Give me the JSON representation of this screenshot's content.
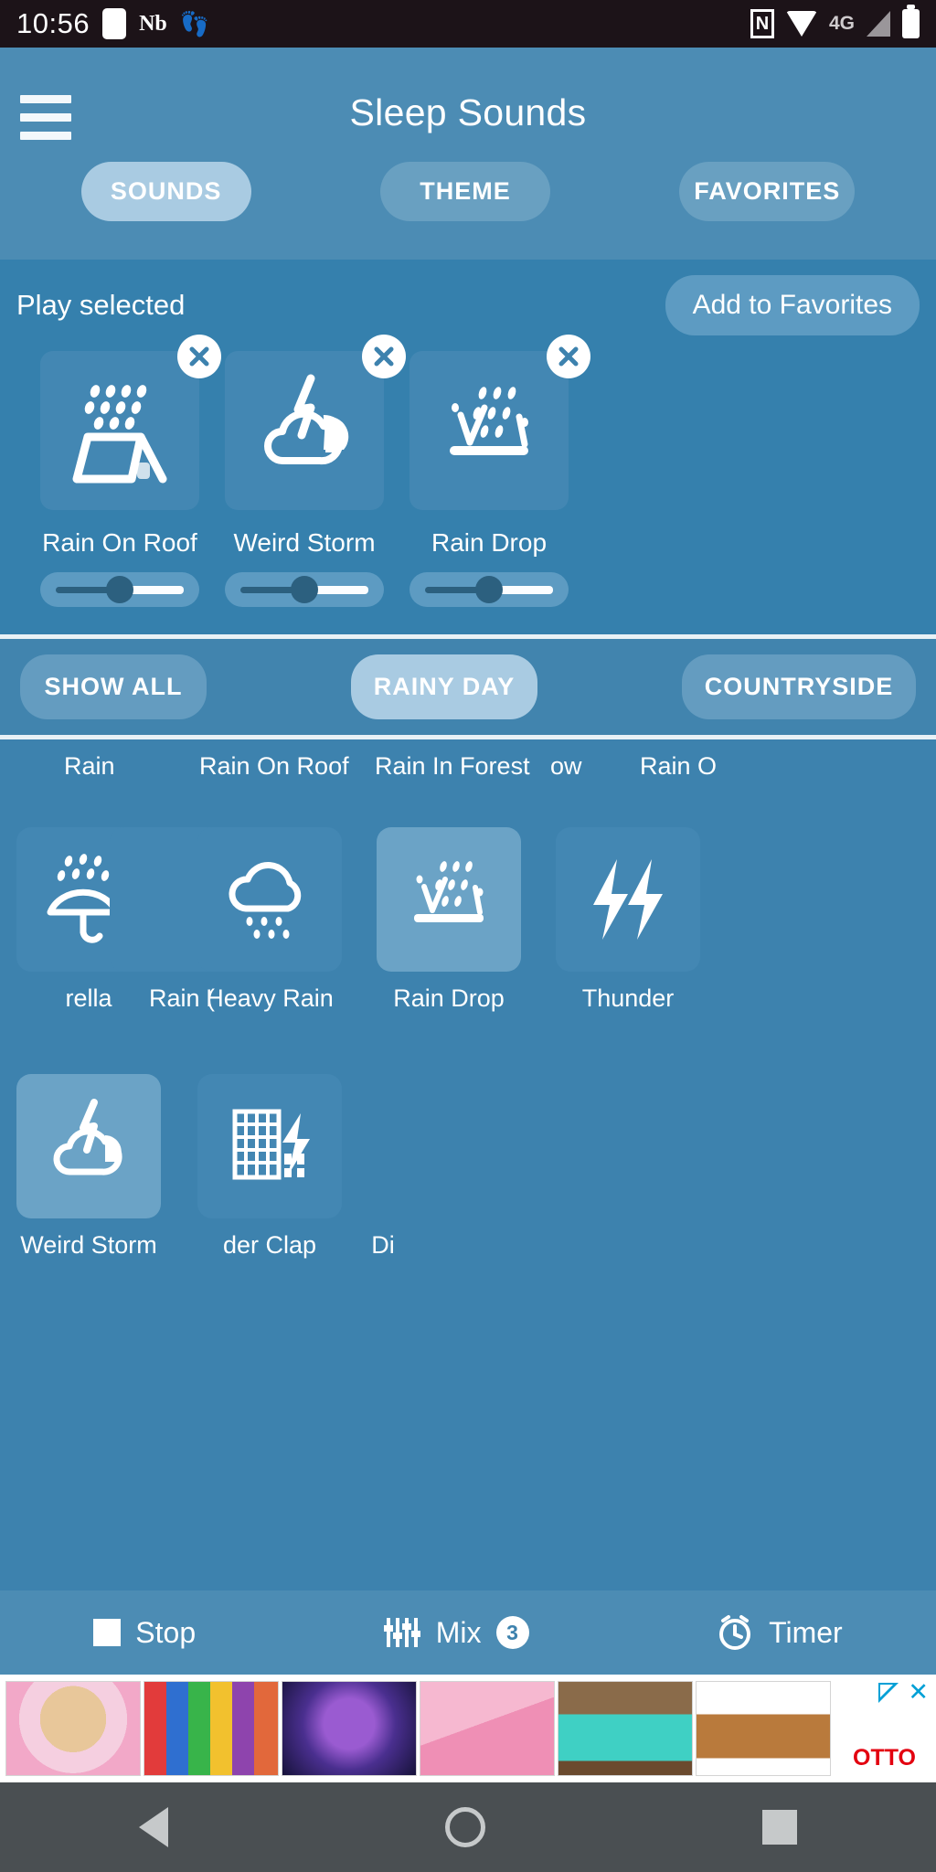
{
  "status_bar": {
    "time": "10:56",
    "left_icons": [
      "blank-notification-icon",
      "nb-icon",
      "footsteps-icon"
    ],
    "right_icons": [
      "nfc-icon",
      "wifi-icon",
      "signal-icon",
      "battery-icon"
    ],
    "network": "4G",
    "nfc_glyph": "N"
  },
  "header": {
    "menu_icon": "hamburger-menu-icon",
    "title": "Sleep Sounds",
    "tabs": [
      {
        "label": "SOUNDS",
        "active": true
      },
      {
        "label": "THEME",
        "active": false
      },
      {
        "label": "FAVORITES",
        "active": false
      }
    ]
  },
  "selected": {
    "play_label": "Play selected",
    "add_favorites_label": "Add to Favorites",
    "items": [
      {
        "label": "Rain On Roof",
        "icon": "rain-on-roof-icon",
        "volume": 50,
        "close_icon": "close-icon"
      },
      {
        "label": "Weird Storm",
        "icon": "weird-storm-icon",
        "volume": 50,
        "close_icon": "close-icon"
      },
      {
        "label": "Rain Drop",
        "icon": "rain-drop-icon",
        "volume": 50,
        "close_icon": "close-icon"
      }
    ]
  },
  "categories": [
    {
      "label": "SHOW ALL",
      "active": false
    },
    {
      "label": "RAINY DAY",
      "active": true
    },
    {
      "label": "COUNTRYSIDE",
      "active": false
    }
  ],
  "sound_list": {
    "top_row_labels": [
      "Rain",
      "Rain On Roof",
      "Rain In Forest",
      "ow",
      "Rain O"
    ],
    "rows": [
      [
        {
          "label": "rella",
          "icon": "umbrella-rain-icon",
          "selected": false,
          "clipped": true
        },
        {
          "label": "Rain (",
          "icon": "rain-icon",
          "selected": false,
          "clipped": true
        },
        {
          "label": "Heavy Rain",
          "icon": "heavy-rain-cloud-icon",
          "selected": false
        },
        {
          "label": "Rain Drop",
          "icon": "rain-drop-icon",
          "selected": true
        },
        {
          "label": "Thunder",
          "icon": "thunder-bolts-icon",
          "selected": false
        }
      ],
      [
        {
          "label": "Weird Storm",
          "icon": "weird-storm-icon",
          "selected": true
        },
        {
          "label": "der Clap",
          "icon": "thunder-clap-building-icon",
          "selected": false,
          "clipped": true
        },
        {
          "label": "Di",
          "icon": "",
          "selected": false,
          "clipped": true
        }
      ]
    ]
  },
  "action_bar": {
    "stop_label": "Stop",
    "stop_icon": "stop-square-icon",
    "mix_label": "Mix",
    "mix_icon": "mixer-sliders-icon",
    "mix_count": "3",
    "timer_label": "Timer",
    "timer_icon": "alarm-clock-icon"
  },
  "ad": {
    "brand": "OTTO",
    "close_icon": "ad-close-icon",
    "choices_icon": "ad-choices-icon",
    "thumbnails": [
      "puppy-toy-thumbnail",
      "colorful-blocks-thumbnail",
      "galaxy-cube-thumbnail",
      "kids-smartwatch-thumbnail",
      "birthday-cake-thumbnail",
      "brown-boot-thumbnail"
    ]
  },
  "nav_bar": {
    "back": "back-nav-icon",
    "home": "home-nav-icon",
    "recents": "recents-nav-icon"
  },
  "colors": {
    "header_blue": "#4c8cb4",
    "body_blue": "#3d82ae",
    "tile_blue": "#4387b3",
    "tile_selected_blue": "#6ba3c6",
    "pill_blue": "#649cc0",
    "pill_active_blue": "#a9cbe2",
    "accent_white": "#ffffff",
    "track_dark": "#2c607f",
    "ad_brand_red": "#e3000f"
  }
}
